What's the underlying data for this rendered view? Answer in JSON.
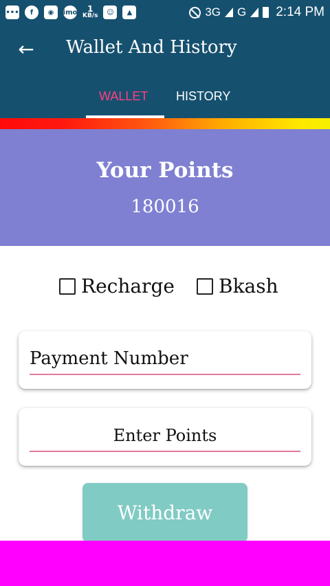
{
  "status_bar": {
    "icons": [
      "chat-icon",
      "facebook-icon",
      "camera-icon",
      "imo-icon",
      "message-icon",
      "image-icon",
      "dnd-icon",
      "signal-icon",
      "battery-icon"
    ],
    "speed_value": "1",
    "speed_unit": "KB/s",
    "network_1": "3G",
    "network_2": "G",
    "time": "2:14 PM",
    "background": "#16506f"
  },
  "app_bar": {
    "title": "Wallet And History",
    "background": "#16506f"
  },
  "tabs": [
    {
      "label": "WALLET",
      "active": true,
      "color": "#ff4081"
    },
    {
      "label": "HISTORY",
      "active": false,
      "color": "#ffffff"
    }
  ],
  "points": {
    "title": "Your Points",
    "value": "180016",
    "background": "#7f80d2"
  },
  "payment_options": [
    {
      "label": "Recharge",
      "checked": false
    },
    {
      "label": "Bkash",
      "checked": false
    }
  ],
  "form": {
    "payment_number_placeholder": "Payment Number",
    "points_placeholder": "Enter Points"
  },
  "withdraw": {
    "label": "Withdraw",
    "background": "#80cbc4"
  },
  "footer": {
    "background": "#ff00ff"
  }
}
